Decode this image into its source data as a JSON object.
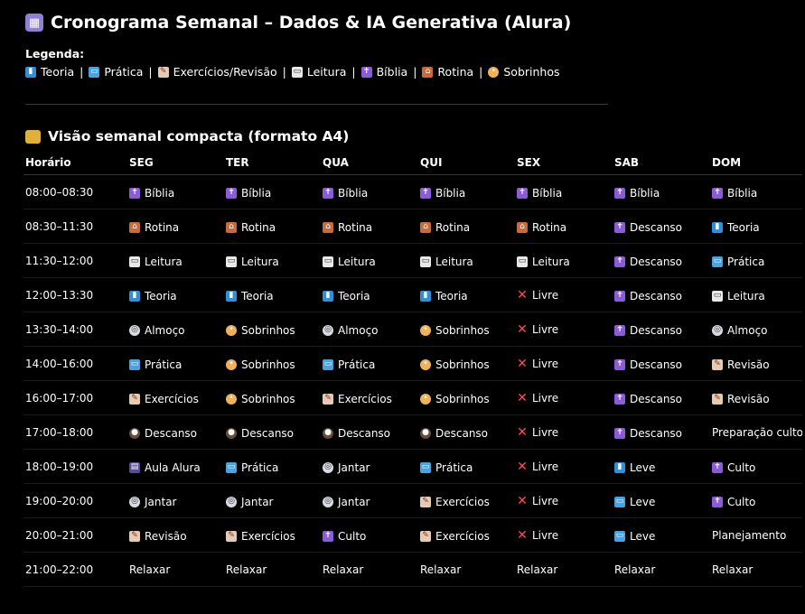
{
  "title": "Cronograma Semanal – Dados & IA Generativa (Alura)",
  "title_icon": "calendar-icon",
  "legend_title": "Legenda:",
  "legend": [
    {
      "icon": "teoria",
      "label": "Teoria"
    },
    {
      "icon": "pratica",
      "label": "Prática"
    },
    {
      "icon": "exercicios",
      "label": "Exercícios/Revisão"
    },
    {
      "icon": "leitura",
      "label": "Leitura"
    },
    {
      "icon": "biblia",
      "label": "Bíblia"
    },
    {
      "icon": "rotina",
      "label": "Rotina"
    },
    {
      "icon": "sobrinhos",
      "label": "Sobrinhos"
    }
  ],
  "section_title": "Visão semanal compacta (formato A4)",
  "section_icon": "folder-icon",
  "headers": [
    "Horário",
    "SEG",
    "TER",
    "QUA",
    "QUI",
    "SEX",
    "SAB",
    "DOM"
  ],
  "rows": [
    {
      "time": "08:00–08:30",
      "cells": [
        {
          "icon": "biblia",
          "text": "Bíblia"
        },
        {
          "icon": "biblia",
          "text": "Bíblia"
        },
        {
          "icon": "biblia",
          "text": "Bíblia"
        },
        {
          "icon": "biblia",
          "text": "Bíblia"
        },
        {
          "icon": "biblia",
          "text": "Bíblia"
        },
        {
          "icon": "biblia",
          "text": "Bíblia"
        },
        {
          "icon": "biblia",
          "text": "Bíblia"
        }
      ]
    },
    {
      "time": "08:30–11:30",
      "cells": [
        {
          "icon": "rotina",
          "text": "Rotina"
        },
        {
          "icon": "rotina",
          "text": "Rotina"
        },
        {
          "icon": "rotina",
          "text": "Rotina"
        },
        {
          "icon": "rotina",
          "text": "Rotina"
        },
        {
          "icon": "rotina",
          "text": "Rotina"
        },
        {
          "icon": "biblia",
          "text": "Descanso"
        },
        {
          "icon": "teoria",
          "text": "Teoria"
        }
      ]
    },
    {
      "time": "11:30–12:00",
      "cells": [
        {
          "icon": "leitura",
          "text": "Leitura"
        },
        {
          "icon": "leitura",
          "text": "Leitura"
        },
        {
          "icon": "leitura",
          "text": "Leitura"
        },
        {
          "icon": "leitura",
          "text": "Leitura"
        },
        {
          "icon": "leitura",
          "text": "Leitura"
        },
        {
          "icon": "biblia",
          "text": "Descanso"
        },
        {
          "icon": "pratica",
          "text": "Prática"
        }
      ]
    },
    {
      "time": "12:00–13:30",
      "cells": [
        {
          "icon": "teoria",
          "text": "Teoria"
        },
        {
          "icon": "teoria",
          "text": "Teoria"
        },
        {
          "icon": "teoria",
          "text": "Teoria"
        },
        {
          "icon": "teoria",
          "text": "Teoria"
        },
        {
          "icon": "livre",
          "text": "Livre"
        },
        {
          "icon": "biblia",
          "text": "Descanso"
        },
        {
          "icon": "leitura",
          "text": "Leitura"
        }
      ]
    },
    {
      "time": "13:30–14:00",
      "cells": [
        {
          "icon": "almoco",
          "text": "Almoço"
        },
        {
          "icon": "sobrinhos",
          "text": "Sobrinhos"
        },
        {
          "icon": "almoco",
          "text": "Almoço"
        },
        {
          "icon": "sobrinhos",
          "text": "Sobrinhos"
        },
        {
          "icon": "livre",
          "text": "Livre"
        },
        {
          "icon": "biblia",
          "text": "Descanso"
        },
        {
          "icon": "almoco",
          "text": "Almoço"
        }
      ]
    },
    {
      "time": "14:00–16:00",
      "cells": [
        {
          "icon": "pratica",
          "text": "Prática"
        },
        {
          "icon": "sobrinhos",
          "text": "Sobrinhos"
        },
        {
          "icon": "pratica",
          "text": "Prática"
        },
        {
          "icon": "sobrinhos",
          "text": "Sobrinhos"
        },
        {
          "icon": "livre",
          "text": "Livre"
        },
        {
          "icon": "biblia",
          "text": "Descanso"
        },
        {
          "icon": "exercicios",
          "text": "Revisão"
        }
      ]
    },
    {
      "time": "16:00–17:00",
      "cells": [
        {
          "icon": "exercicios",
          "text": "Exercícios"
        },
        {
          "icon": "sobrinhos",
          "text": "Sobrinhos"
        },
        {
          "icon": "exercicios",
          "text": "Exercícios"
        },
        {
          "icon": "sobrinhos",
          "text": "Sobrinhos"
        },
        {
          "icon": "livre",
          "text": "Livre"
        },
        {
          "icon": "biblia",
          "text": "Descanso"
        },
        {
          "icon": "exercicios",
          "text": "Revisão"
        }
      ]
    },
    {
      "time": "17:00–18:00",
      "cells": [
        {
          "icon": "descanso",
          "text": "Descanso"
        },
        {
          "icon": "descanso",
          "text": "Descanso"
        },
        {
          "icon": "descanso",
          "text": "Descanso"
        },
        {
          "icon": "descanso",
          "text": "Descanso"
        },
        {
          "icon": "livre",
          "text": "Livre"
        },
        {
          "icon": "biblia",
          "text": "Descanso"
        },
        {
          "icon": "",
          "text": "Preparação culto"
        }
      ]
    },
    {
      "time": "18:00–19:00",
      "cells": [
        {
          "icon": "aula",
          "text": "Aula Alura"
        },
        {
          "icon": "pratica",
          "text": "Prática"
        },
        {
          "icon": "almoco",
          "text": "Jantar"
        },
        {
          "icon": "pratica",
          "text": "Prática"
        },
        {
          "icon": "livre",
          "text": "Livre"
        },
        {
          "icon": "teoria",
          "text": "Leve"
        },
        {
          "icon": "biblia",
          "text": "Culto"
        }
      ]
    },
    {
      "time": "19:00–20:00",
      "cells": [
        {
          "icon": "almoco",
          "text": "Jantar"
        },
        {
          "icon": "almoco",
          "text": "Jantar"
        },
        {
          "icon": "almoco",
          "text": "Jantar"
        },
        {
          "icon": "exercicios",
          "text": "Exercícios"
        },
        {
          "icon": "livre",
          "text": "Livre"
        },
        {
          "icon": "pratica",
          "text": "Leve"
        },
        {
          "icon": "biblia",
          "text": "Culto"
        }
      ]
    },
    {
      "time": "20:00–21:00",
      "cells": [
        {
          "icon": "exercicios",
          "text": "Revisão"
        },
        {
          "icon": "exercicios",
          "text": "Exercícios"
        },
        {
          "icon": "biblia",
          "text": "Culto"
        },
        {
          "icon": "exercicios",
          "text": "Exercícios"
        },
        {
          "icon": "livre",
          "text": "Livre"
        },
        {
          "icon": "pratica",
          "text": "Leve"
        },
        {
          "icon": "",
          "text": "Planejamento"
        }
      ]
    },
    {
      "time": "21:00–22:00",
      "cells": [
        {
          "icon": "",
          "text": "Relaxar"
        },
        {
          "icon": "",
          "text": "Relaxar"
        },
        {
          "icon": "",
          "text": "Relaxar"
        },
        {
          "icon": "",
          "text": "Relaxar"
        },
        {
          "icon": "",
          "text": "Relaxar"
        },
        {
          "icon": "",
          "text": "Relaxar"
        },
        {
          "icon": "",
          "text": "Relaxar"
        }
      ]
    }
  ]
}
